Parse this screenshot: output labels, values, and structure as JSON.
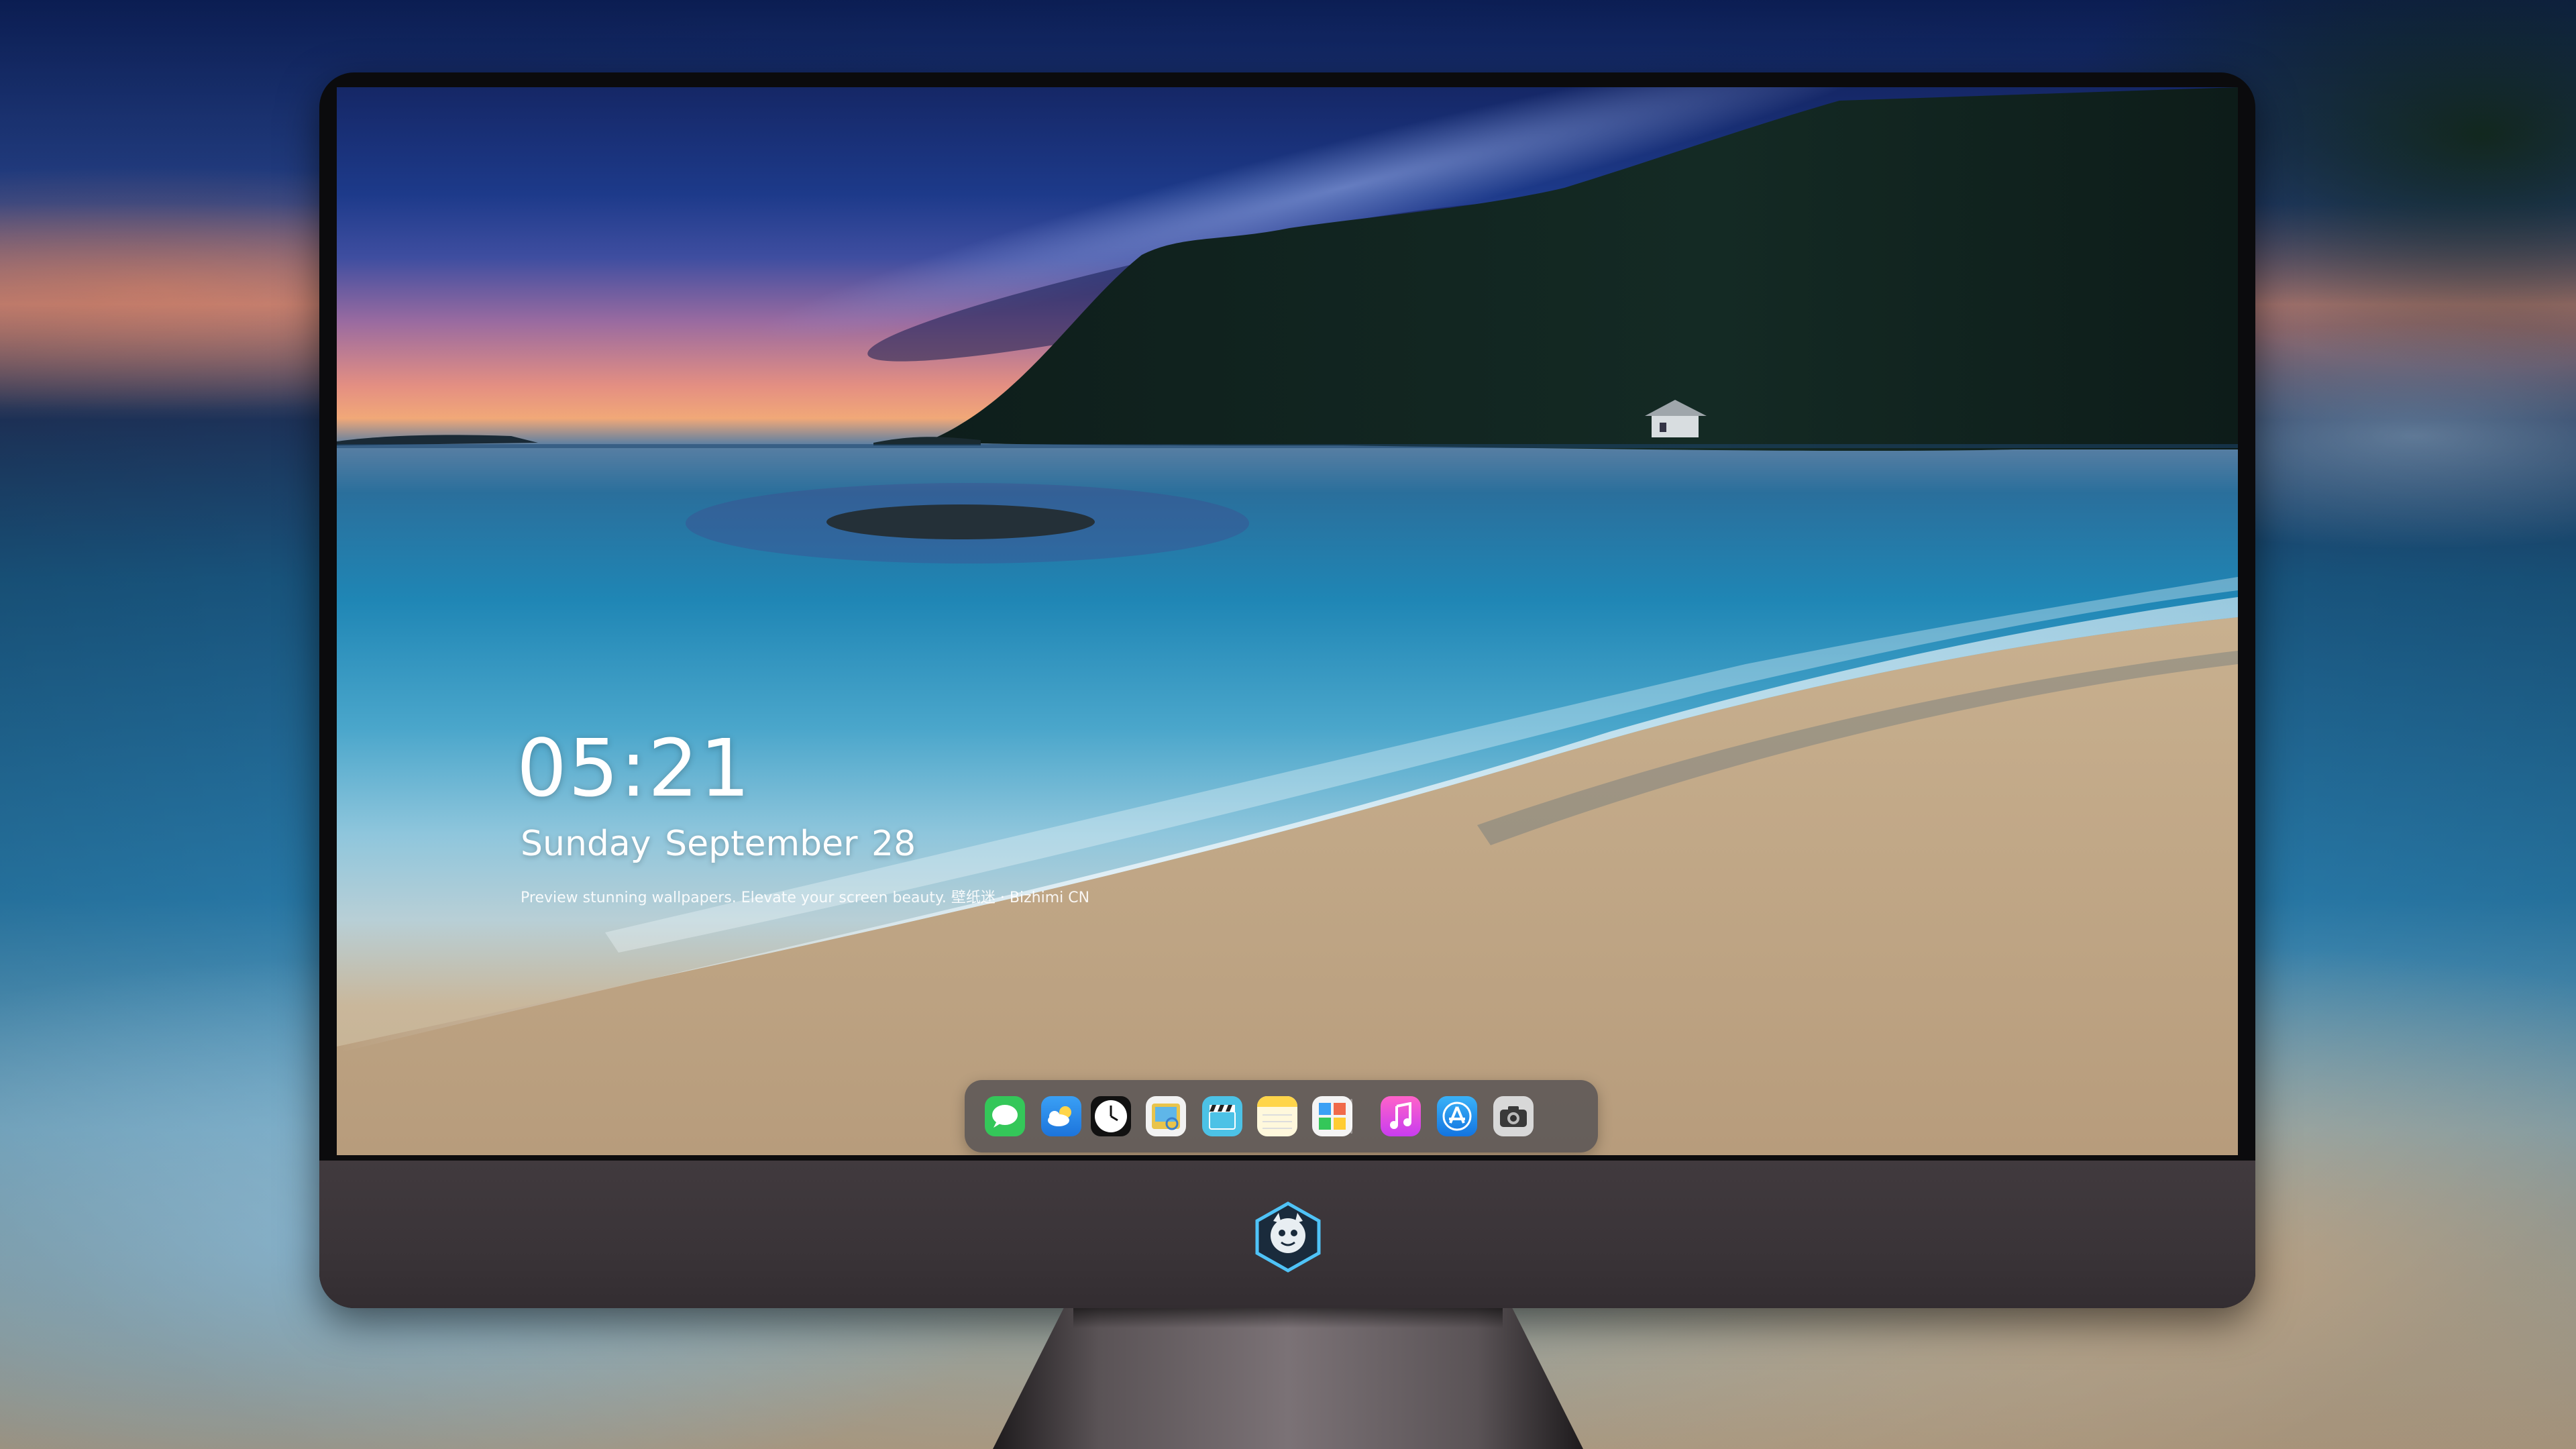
{
  "lock_screen": {
    "time": "05:21",
    "date": "Sunday September  28",
    "caption": "Preview stunning wallpapers. Elevate your screen beauty. 壁纸迷 · Bizhimi CN"
  },
  "dock": {
    "apps": [
      {
        "name": "messages",
        "icon": "messages-icon",
        "color": "#34c759"
      },
      {
        "name": "weather",
        "icon": "weather-icon",
        "color": "#2f8cf0"
      },
      {
        "name": "clock",
        "icon": "clock-icon",
        "color": "#111111"
      },
      {
        "name": "preview",
        "icon": "preview-icon",
        "color": "#f2f2f2"
      },
      {
        "name": "clips",
        "icon": "clapperboard-icon",
        "color": "#4cc2e6"
      },
      {
        "name": "notes",
        "icon": "notes-icon",
        "color": "#ffd54a"
      },
      {
        "name": "photos",
        "icon": "photo-grid-icon",
        "color": "#f4f4f4"
      },
      {
        "name": "music",
        "icon": "music-icon",
        "color": "#f04bd0"
      },
      {
        "name": "app-store",
        "icon": "app-store-icon",
        "color": "#1f9cf0"
      },
      {
        "name": "camera",
        "icon": "camera-icon",
        "color": "#d8d8d8"
      }
    ]
  },
  "monitor": {
    "logo": "mascot-logo-icon"
  }
}
